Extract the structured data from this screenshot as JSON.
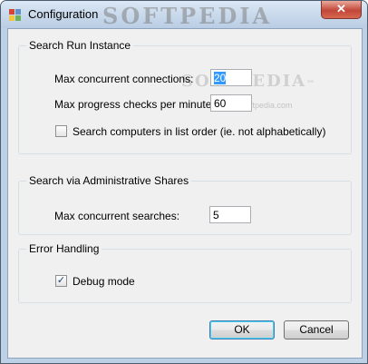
{
  "window": {
    "title": "Configuration",
    "close_glyph": "✕",
    "watermark": "SOFTPEDIA"
  },
  "content_watermark": {
    "main": "SOFTPEDIA",
    "tm": "™",
    "sub": "www.softpedia.com"
  },
  "search_run_instance": {
    "title": "Search Run Instance",
    "max_connections_label": "Max concurrent connections:",
    "max_connections_value": "20",
    "max_progress_label": "Max progress checks per minute:",
    "max_progress_value": "60",
    "list_order_label": "Search computers in list order (ie. not alphabetically)",
    "list_order_checked": false
  },
  "admin_shares": {
    "title": "Search via Administrative Shares",
    "max_searches_label": "Max concurrent searches:",
    "max_searches_value": "5"
  },
  "error_handling": {
    "title": "Error Handling",
    "debug_label": "Debug mode",
    "debug_checked": true,
    "check_glyph": "✓"
  },
  "buttons": {
    "ok": "OK",
    "cancel": "Cancel"
  },
  "icons": {
    "app": "config-app-icon",
    "close": "close-icon",
    "check": "checkmark-icon"
  },
  "colors": {
    "titlebar": "#bcd0e6",
    "close": "#c2473a",
    "selection": "#3399ff",
    "client": "#f0f0f0"
  }
}
